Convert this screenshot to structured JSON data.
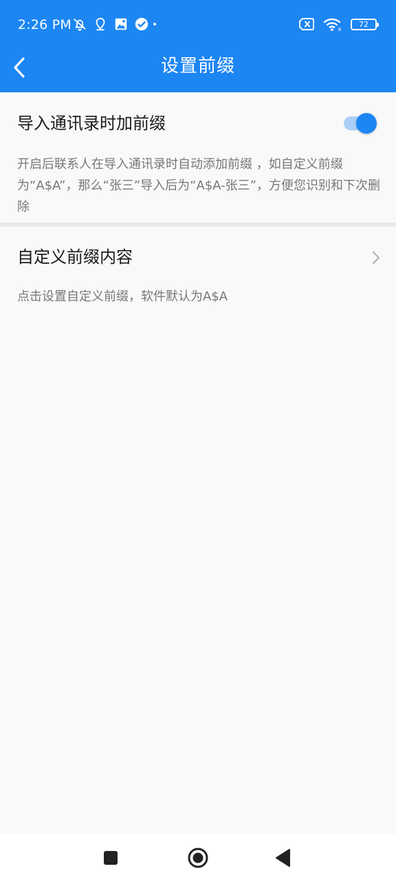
{
  "status_bar": {
    "time": "2:26 PM",
    "battery": "72",
    "left_icons": [
      "mute-bell-icon",
      "location-pin-icon",
      "image-icon",
      "check-circle-icon"
    ],
    "right_icons": [
      "sim-error-icon",
      "wifi-icon",
      "battery-icon"
    ]
  },
  "header": {
    "title": "设置前缀",
    "back_icon": "back-arrow-icon",
    "background_color": "#1c86f3"
  },
  "settings": {
    "import_prefix": {
      "title": "导入通讯录时加前缀",
      "description": "开启后联系人在导入通讯录时自动添加前缀 ，如自定义前缀为“A$A”，那么“张三”导入后为“A$A-张三”，方便您识别和下次删除",
      "toggle_on": true
    },
    "custom_prefix": {
      "title": "自定义前缀内容",
      "description": "点击设置自定义前缀，软件默认为A$A",
      "chevron_icon": "chevron-right-icon"
    }
  },
  "nav_bar": {
    "buttons": [
      "recents-square-icon",
      "home-circle-icon",
      "back-triangle-icon"
    ]
  }
}
